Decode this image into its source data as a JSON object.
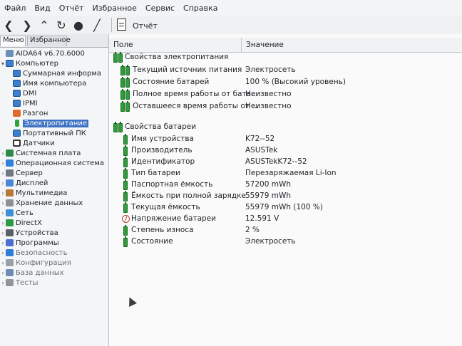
{
  "menubar": [
    "Файл",
    "Вид",
    "Отчёт",
    "Избранное",
    "Сервис",
    "Справка"
  ],
  "toolbar": {
    "report_label": "Отчёт"
  },
  "left_tabs": {
    "menu": "Меню",
    "favorites": "Избранное"
  },
  "tree": {
    "root": "AIDA64 v6.70.6000",
    "computer": "Компьютер",
    "computer_children": [
      "Суммарная информа",
      "Имя компьютера",
      "DMI",
      "IPMI",
      "Разгон",
      "Электропитание",
      "Портативный ПК",
      "Датчики"
    ],
    "top_level": [
      "Системная плата",
      "Операционная система",
      "Сервер",
      "Дисплей",
      "Мультимедиа",
      "Хранение данных",
      "Сеть",
      "DirectX",
      "Устройства",
      "Программы",
      "Безопасность",
      "Конфигурация",
      "База данных",
      "Тесты"
    ]
  },
  "table": {
    "headers": {
      "field": "Поле",
      "value": "Значение"
    },
    "groups": [
      {
        "title": "Свойства электропитания",
        "rows": [
          {
            "field": "Текущий источник питания",
            "value": "Электросеть"
          },
          {
            "field": "Состояние батарей",
            "value": "100 % (Высокий уровень)"
          },
          {
            "field": "Полное время работы от бата...",
            "value": "Неизвестно"
          },
          {
            "field": "Оставшееся время работы от ...",
            "value": "Неизвестно"
          }
        ]
      },
      {
        "title": "Свойства батареи",
        "rows": [
          {
            "field": "Имя устройства",
            "value": "K72--52",
            "icon": "battery-icon"
          },
          {
            "field": "Производитель",
            "value": "ASUSTek",
            "icon": "battery-icon"
          },
          {
            "field": "Идентификатор",
            "value": "ASUSTekK72--52",
            "icon": "battery-icon"
          },
          {
            "field": "Тип батареи",
            "value": "Перезаряжаемая Li-Ion",
            "icon": "battery-icon"
          },
          {
            "field": "Паспортная ёмкость",
            "value": "57200 mWh",
            "icon": "battery-icon"
          },
          {
            "field": "Ёмкость при полной зарядке",
            "value": "55979 mWh",
            "icon": "battery-icon"
          },
          {
            "field": "Текущая ёмкость",
            "value": "55979 mWh  (100 %)",
            "icon": "battery-icon"
          },
          {
            "field": "Напряжение батареи",
            "value": "12.591 V",
            "icon": "voltage-icon"
          },
          {
            "field": "Степень износа",
            "value": "2 %",
            "icon": "battery-icon"
          },
          {
            "field": "Состояние",
            "value": "Электросеть",
            "icon": "battery-icon"
          }
        ]
      }
    ]
  }
}
